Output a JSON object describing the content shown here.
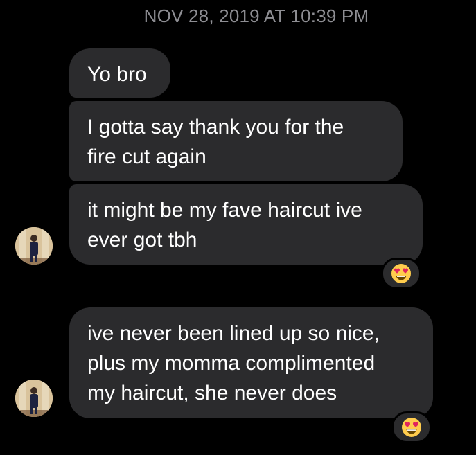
{
  "timestamp": "NOV 28, 2019 AT 10:39 PM",
  "messages": [
    {
      "lines": [
        "Yo bro"
      ]
    },
    {
      "lines": [
        "I gotta say thank you for the",
        "fire cut again"
      ]
    },
    {
      "lines": [
        "it might be my fave haircut ive",
        "ever got tbh"
      ],
      "reaction": "heart-eyes-emoji"
    },
    {
      "lines": [
        "ive never been lined up so nice,",
        "plus my momma complimented",
        "my haircut, she never does"
      ],
      "reaction": "heart-eyes-emoji"
    }
  ],
  "colors": {
    "background": "#000000",
    "bubble": "#2b2b2d",
    "timestamp": "#8e8e93",
    "text": "#ffffff"
  }
}
